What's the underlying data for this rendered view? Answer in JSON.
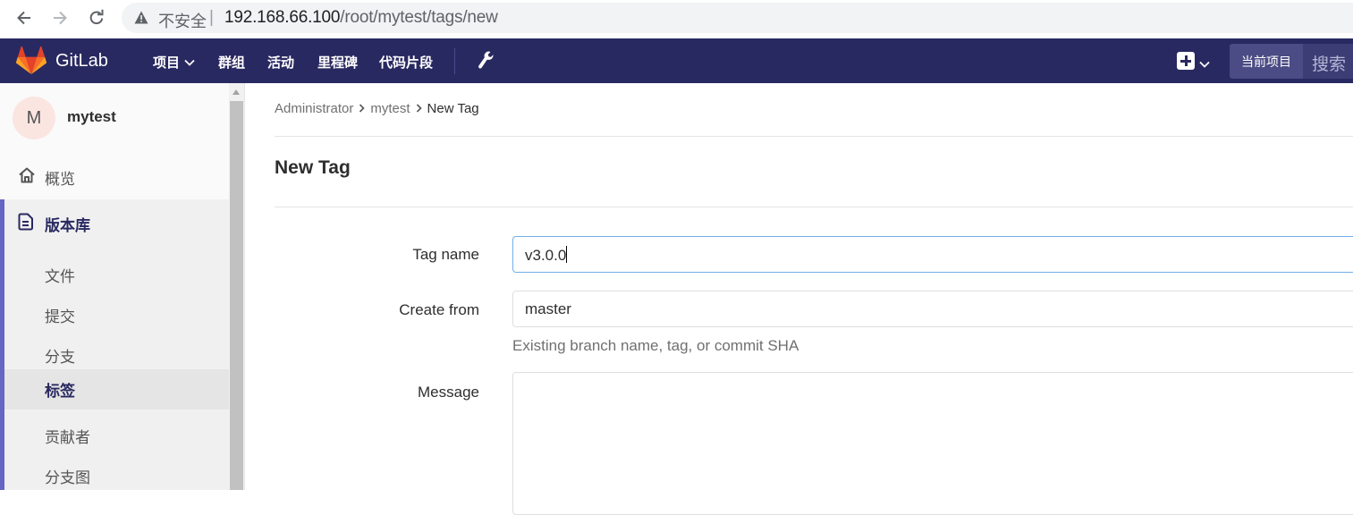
{
  "browser": {
    "insecure_label": "不安全",
    "url_host": "192.168.66.100",
    "url_path": "/root/mytest/tags/new"
  },
  "header": {
    "brand": "GitLab",
    "nav": [
      "项目",
      "群组",
      "活动",
      "里程碑",
      "代码片段"
    ],
    "search_scope": "当前项目",
    "search_placeholder": "搜索",
    "brand_color": "#292961"
  },
  "sidebar": {
    "avatar_letter": "M",
    "project_name": "mytest",
    "overview": "概览",
    "repository": "版本库",
    "items": [
      {
        "label": "文件",
        "active": false
      },
      {
        "label": "提交",
        "active": false
      },
      {
        "label": "分支",
        "active": false
      },
      {
        "label": "标签",
        "active": true
      },
      {
        "label": "贡献者",
        "active": false
      },
      {
        "label": "分支图",
        "active": false
      }
    ]
  },
  "breadcrumb": [
    "Administrator",
    "mytest",
    "New Tag"
  ],
  "page": {
    "title": "New Tag"
  },
  "form": {
    "tag_name_label": "Tag name",
    "tag_name_value": "v3.0.0",
    "create_from_label": "Create from",
    "create_from_value": "master",
    "create_from_help": "Existing branch name, tag, or commit SHA",
    "message_label": "Message",
    "message_value": ""
  }
}
